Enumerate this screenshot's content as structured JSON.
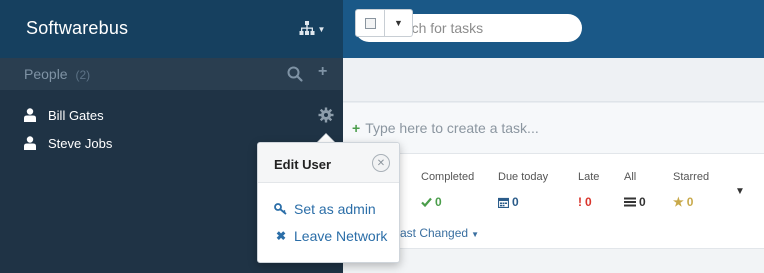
{
  "app": {
    "name": "Softwarebus"
  },
  "header": {
    "search_placeholder": "Search for tasks"
  },
  "people": {
    "title": "People",
    "count": "(2)",
    "users": [
      {
        "name": "Bill Gates"
      },
      {
        "name": "Steve Jobs"
      }
    ]
  },
  "tasks": {
    "new_task_placeholder": "Type here to create a task..."
  },
  "stats": [
    {
      "label": "Completed",
      "value": "0",
      "icon": "check-icon",
      "color": "#4a9d4a"
    },
    {
      "label": "Due today",
      "value": "0",
      "icon": "calendar-icon",
      "color": "#2b5c8a"
    },
    {
      "label": "Late",
      "value": "0",
      "icon": "exclamation-icon",
      "color": "#d9342b"
    },
    {
      "label": "All",
      "value": "0",
      "icon": "list-icon",
      "color": "#333333"
    },
    {
      "label": "Starred",
      "value": "0",
      "icon": "star-icon",
      "color": "#c8a94a"
    }
  ],
  "sort": {
    "label": "ast Changed"
  },
  "popover": {
    "title": "Edit User",
    "items": [
      {
        "label": "Set as admin",
        "icon": "key-icon"
      },
      {
        "label": "Leave Network",
        "icon": "x-icon"
      }
    ]
  },
  "colors": {
    "sidebar_bg": "#1f3345",
    "header_bg": "#16405f",
    "topbar_bg": "#1a5887",
    "link": "#2b6ea8"
  }
}
